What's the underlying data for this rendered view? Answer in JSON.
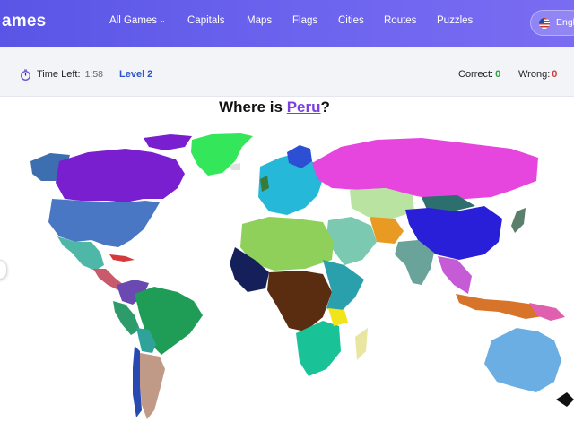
{
  "header": {
    "brand": "ames",
    "nav": [
      {
        "label": "All Games",
        "has_dropdown": true
      },
      {
        "label": "Capitals"
      },
      {
        "label": "Maps"
      },
      {
        "label": "Flags"
      },
      {
        "label": "Cities"
      },
      {
        "label": "Routes"
      },
      {
        "label": "Puzzles"
      }
    ],
    "language": {
      "label": "Engl",
      "flag_icon": "us-flag-icon"
    }
  },
  "status": {
    "time_label": "Time Left:",
    "time_value": "1:58",
    "level": "Level 2",
    "correct_label": "Correct:",
    "correct_value": "0",
    "wrong_label": "Wrong:",
    "wrong_value": "0"
  },
  "question": {
    "prefix": "Where is ",
    "target": "Peru",
    "suffix": "?"
  },
  "colors": {
    "header_gradient": [
      "#5a55e6",
      "#7a6cf2"
    ],
    "level": "#2c55c9",
    "correct": "#2c9e3f",
    "wrong": "#d23b3b",
    "target": "#7b3fe2"
  },
  "icons": [
    "timer-icon",
    "chevron-down-icon",
    "us-flag-icon"
  ]
}
